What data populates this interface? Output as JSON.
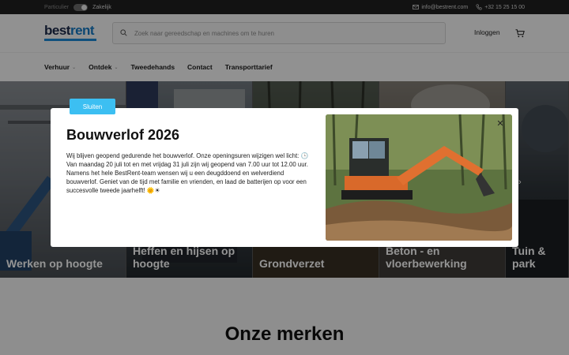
{
  "topbar": {
    "segment_left": "Particulier",
    "segment_right": "Zakelijk",
    "email": "info@bestrent.com",
    "phone": "+32 15 25 15 00"
  },
  "header": {
    "logo_part1": "best",
    "logo_part2": "rent",
    "search_placeholder": "Zoek naar gereedschap en machines om te huren",
    "login": "Inloggen"
  },
  "nav": {
    "items": [
      {
        "label": "Verhuur",
        "dropdown": true
      },
      {
        "label": "Ontdek",
        "dropdown": true
      },
      {
        "label": "Tweedehands",
        "dropdown": false
      },
      {
        "label": "Contact",
        "dropdown": false
      },
      {
        "label": "Transporttarief",
        "dropdown": false
      }
    ]
  },
  "categories": [
    {
      "label": "Werken op hoogte"
    },
    {
      "label": "Heffen en hijsen op hoogte"
    },
    {
      "label": "Grondverzet"
    },
    {
      "label": "Beton - en vloerbewerking"
    },
    {
      "label": "Tuin & park"
    }
  ],
  "brands": {
    "title": "Onze merken"
  },
  "modal": {
    "title": "Bouwverlof 2026",
    "body": "Wij blijven geopend gedurende het bouwverlof. Onze openingsuren wijzigen wel licht: 🕒 Van maandag 20 juli tot en met vrijdag 31 juli zijn wij geopend van 7.00 uur tot 12.00 uur. Namens het hele BestRent-team wensen wij u een deugddoend en welverdiend bouwverlof. Geniet van de tijd met familie en vrienden, en laad de batterijen op voor een succesvolle tweede jaarhelft! 🌞☀",
    "button": "Sluiten",
    "close_icon": "close-icon"
  },
  "colors": {
    "accent": "#3cbff2",
    "topbar": "#1f1f1f",
    "brand_blue": "#1479c4"
  }
}
